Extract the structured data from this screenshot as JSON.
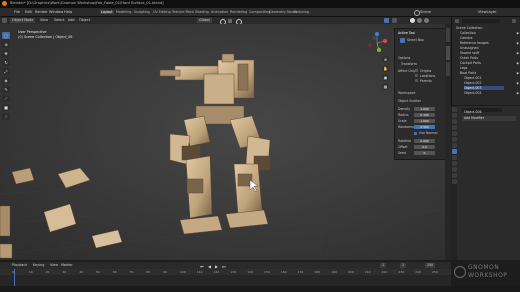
{
  "titlebar": {
    "title": "Blender* [D:\\Graphics\\Work\\Gnomon Workshop\\Fab_Fable_01\\Hard Surface_01.blend]"
  },
  "menubar": {
    "items": [
      "File",
      "Edit",
      "Render",
      "Window",
      "Help"
    ],
    "workspaces": [
      "Layout",
      "Modeling",
      "Sculpting",
      "UV Editing",
      "Texture Paint",
      "Shading",
      "Animation",
      "Rendering",
      "Compositing",
      "Geometry Nodes",
      "Scripting"
    ],
    "active_workspace": "Layout",
    "scene_label": "Scene",
    "view_layer_label": "ViewLayer"
  },
  "viewport_header": {
    "mode": "Object Mode",
    "menus": [
      "View",
      "Select",
      "Add",
      "Object"
    ],
    "transform": "Global",
    "overlay_text": [
      "User Perspective",
      "(0) Scene Collection | Object_06"
    ]
  },
  "npanel": {
    "title": "Active Tool",
    "select_box": "Select Box",
    "options_label": "Options",
    "transform_label": "Transform",
    "affect_only": "Affect Only",
    "origins": "Origins",
    "locations": "Locations",
    "parents": "Parents",
    "workspace": "Workspace",
    "object_scatter": "Object Scatter",
    "fields": [
      {
        "label": "Density",
        "value": "1.000"
      },
      {
        "label": "Radius",
        "value": "0.100"
      },
      {
        "label": "Scale",
        "value": "1.000"
      },
      {
        "label": "Randomness",
        "value": "0.500"
      },
      {
        "label": "Rotation",
        "value": "0.000"
      },
      {
        "label": "Offset",
        "value": "0.0"
      },
      {
        "label": "Seed",
        "value": "0"
      }
    ],
    "use_normal_label": "Use Normal"
  },
  "outliner": {
    "header": "Scene Collection",
    "rows": [
      {
        "label": "Collection",
        "selected": false
      },
      {
        "label": "Camera",
        "selected": false
      },
      {
        "label": "Reference Images",
        "selected": false
      },
      {
        "label": "Unassigned",
        "selected": false
      },
      {
        "label": "Shame stuff",
        "selected": false
      },
      {
        "label": "Outer Parts",
        "selected": false
      },
      {
        "label": "Cockpit Parts",
        "selected": false
      },
      {
        "label": "Legs",
        "selected": false
      },
      {
        "label": "Boot Parts",
        "selected": false
      },
      {
        "label": "Object.001",
        "selected": false
      },
      {
        "label": "Object.002",
        "selected": false
      },
      {
        "label": "Object.003",
        "selected": true
      },
      {
        "label": "Object.004",
        "selected": false
      }
    ]
  },
  "properties": {
    "object_name": "Object.006",
    "section": "Add Modifier"
  },
  "timeline": {
    "menus": [
      "Playback",
      "Keying",
      "View",
      "Marker"
    ],
    "frames": [
      "0",
      "10",
      "20",
      "30",
      "40",
      "50",
      "60",
      "70",
      "80",
      "90",
      "100",
      "110",
      "120",
      "130",
      "140",
      "150",
      "160",
      "170",
      "180",
      "190",
      "200",
      "210",
      "220",
      "230",
      "240",
      "250"
    ],
    "current_frame": "1",
    "start": "1",
    "end": "250"
  },
  "watermark": {
    "line1": "GNOMON",
    "line2": "WORKSHOP"
  },
  "colors": {
    "accent": "#4772b3",
    "viewport_bg": "#3a3a3a",
    "panel_bg": "#2b2b2b",
    "robot": "#c8ac86"
  }
}
